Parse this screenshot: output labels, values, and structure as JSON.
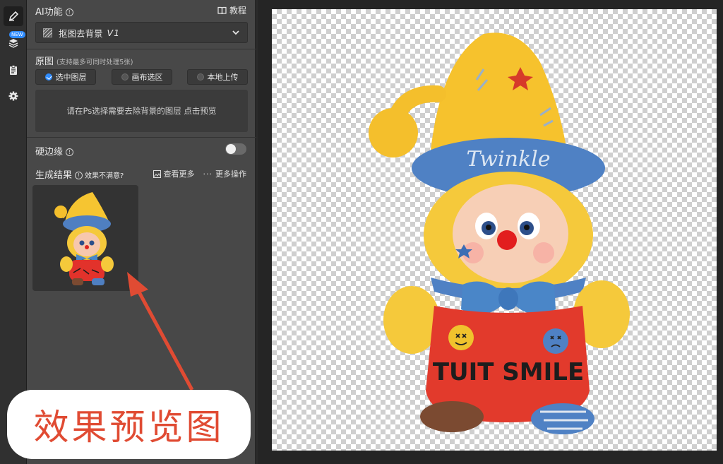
{
  "rail": {
    "new_badge": "NEW",
    "icons": [
      "brush-icon",
      "layers-icon",
      "clipboard-icon",
      "gear-icon"
    ]
  },
  "ai": {
    "title": "AI功能",
    "tutorial_label": "教程",
    "selected_tool": "抠图去背景",
    "selected_version": "V1"
  },
  "source": {
    "title": "原图",
    "note": "(支持最多可同时处理5张)",
    "options": [
      "选中图层",
      "画布选区",
      "本地上传"
    ],
    "selected_index": 0,
    "hint": "请在Ps选择需要去除背景的图层 点击预览"
  },
  "hard_edge": {
    "label": "硬边缘",
    "enabled": false
  },
  "results": {
    "title": "生成结果",
    "feedback": "效果不满意?",
    "view_more": "查看更多",
    "more_actions": "更多操作"
  },
  "toy": {
    "hat_text": "Twinkle",
    "belly_text": "TUIT SMILE"
  },
  "annotation": {
    "callout_text": "效果预览图"
  },
  "colors": {
    "accent": "#2f8cff",
    "annotation_red": "#e04b33",
    "panel_bg": "#484848"
  }
}
